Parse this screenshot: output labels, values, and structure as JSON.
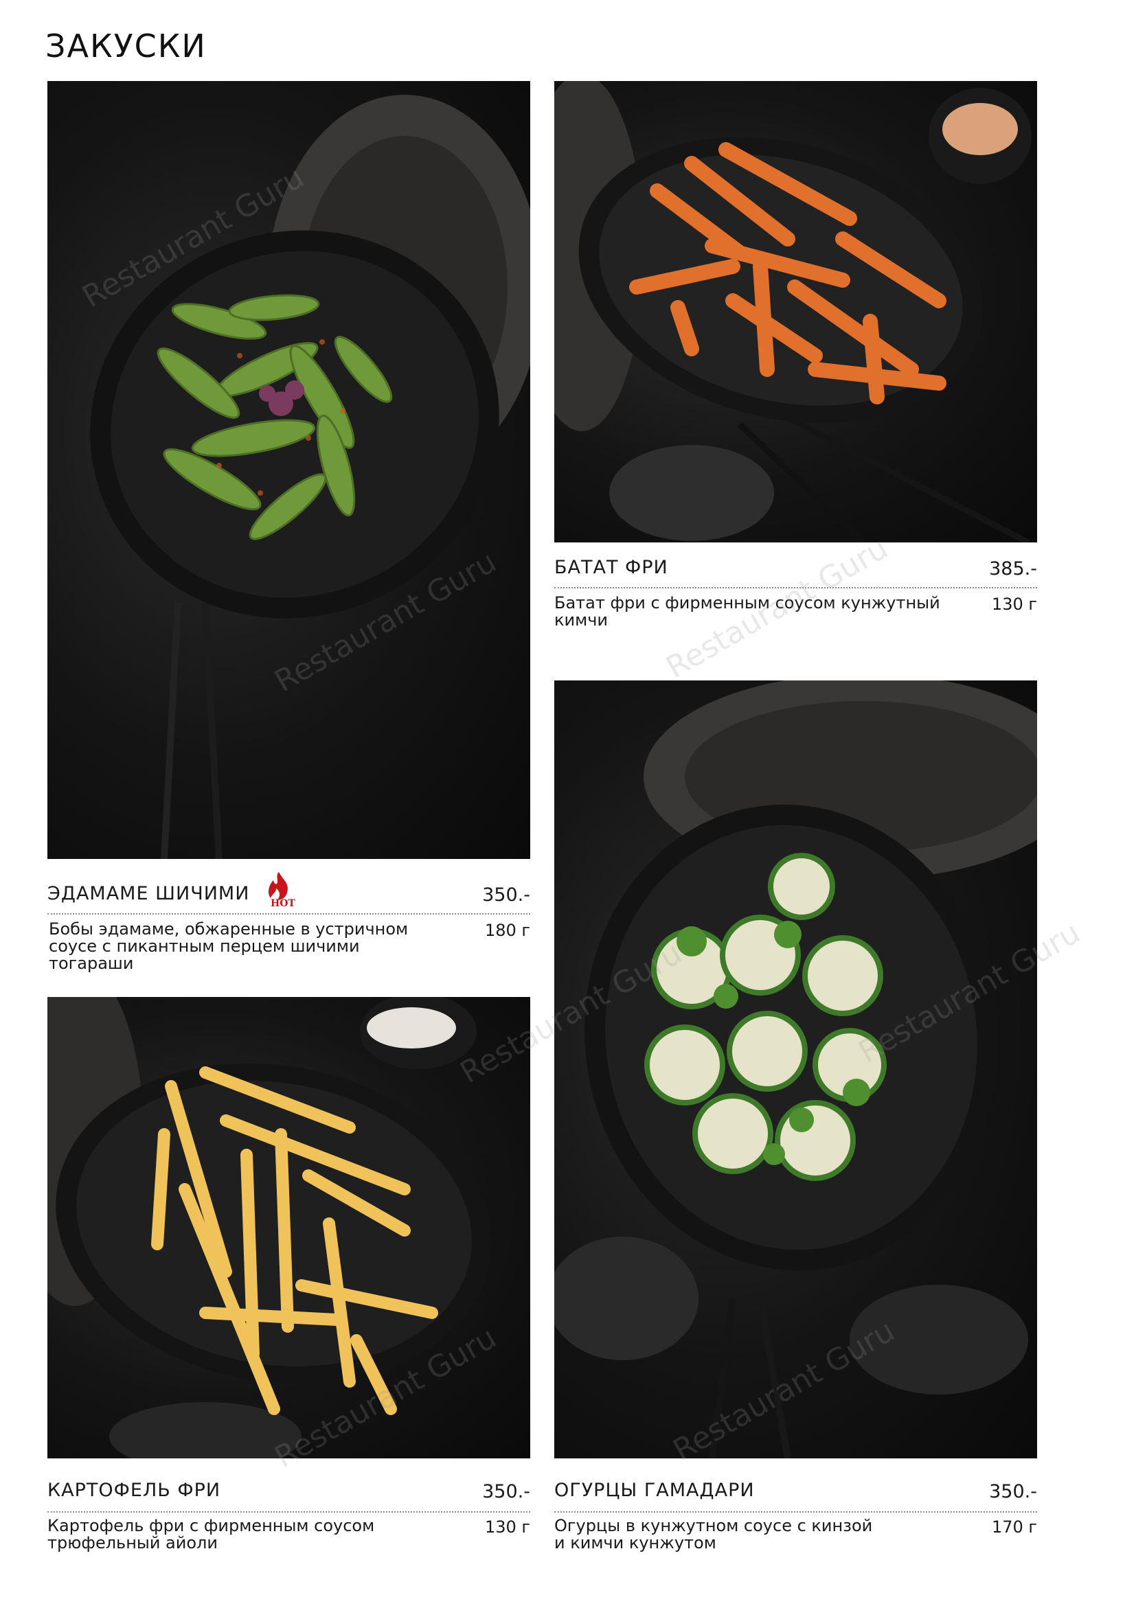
{
  "page": {
    "title": "ЗАКУСКИ"
  },
  "colors": {
    "background": "#ffffff",
    "text": "#1a1a1a",
    "dots": "#8a8a8a",
    "hot_badge": "#c8141c"
  },
  "watermark": "Restaurant Guru",
  "items": [
    {
      "name": "ЭДАМАМЕ ШИЧИМИ",
      "price": "350.-",
      "description_lines": [
        "Бобы эдамаме, обжаренные в устричном",
        "соусе с пикантным перцем  шичими тогараши"
      ],
      "weight": "180 г",
      "badge": {
        "icon": "flame-icon",
        "label": "HOT"
      }
    },
    {
      "name": "БАТАТ ФРИ",
      "price": "385.-",
      "description_lines": [
        "Батат фри с фирменным соусом кунжутный кимчи"
      ],
      "weight": "130 г"
    },
    {
      "name": "КАРТОФЕЛЬ ФРИ",
      "price": "350.-",
      "description_lines": [
        "Картофель фри с фирменным соусом",
        "трюфельный айоли"
      ],
      "weight": "130 г"
    },
    {
      "name": "ОГУРЦЫ ГАМАДАРИ",
      "price": "350.-",
      "description_lines": [
        "Огурцы в кунжутном соусе с кинзой",
        "и кимчи кунжутом"
      ],
      "weight": "170 г"
    }
  ]
}
